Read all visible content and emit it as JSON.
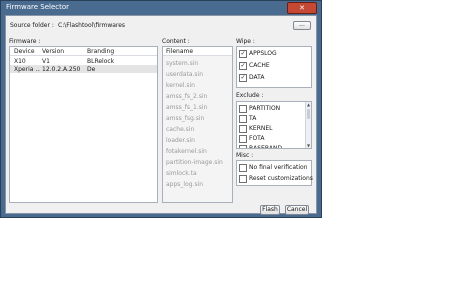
{
  "window": {
    "title": "Firmware Selector",
    "close_glyph": "✕"
  },
  "source": {
    "label": "Source folder :",
    "path": "C:\\Flashtool\\firmwares",
    "browse_label": "..."
  },
  "firmware": {
    "label": "Firmware :",
    "columns": [
      "Device",
      "Version",
      "Branding"
    ],
    "rows": [
      {
        "device": "X10",
        "version": "V1",
        "branding": "BLRelock",
        "selected": false
      },
      {
        "device": "Xperia ...",
        "version": "12.0.2.A.250",
        "branding": "De",
        "selected": true
      }
    ]
  },
  "content": {
    "label": "Content :",
    "column": "Filename",
    "items": [
      "system.sin",
      "userdata.sin",
      "kernel.sin",
      "amss_fs_2.sin",
      "amss_fs_1.sin",
      "amss_fsg.sin",
      "cache.sin",
      "loader.sin",
      "fotakernel.sin",
      "partition-image.sin",
      "simlock.ta",
      "apps_log.sin"
    ]
  },
  "wipe": {
    "label": "Wipe :",
    "items": [
      {
        "label": "APPSLOG",
        "checked": true
      },
      {
        "label": "CACHE",
        "checked": true
      },
      {
        "label": "DATA",
        "checked": true
      }
    ]
  },
  "exclude": {
    "label": "Exclude :",
    "items": [
      {
        "label": "PARTITION",
        "checked": false
      },
      {
        "label": "TA",
        "checked": false
      },
      {
        "label": "KERNEL",
        "checked": false
      },
      {
        "label": "FOTA",
        "checked": false
      },
      {
        "label": "BASEBAND",
        "checked": false
      }
    ]
  },
  "misc": {
    "label": "Misc :",
    "items": [
      {
        "label": "No final verification",
        "checked": false
      },
      {
        "label": "Reset customizations",
        "checked": false
      }
    ]
  },
  "buttons": {
    "flash": "Flash",
    "cancel": "Cancel"
  },
  "colors": {
    "titlebar": "#4a6b90",
    "close": "#c44834",
    "client": "#f0f0f0",
    "selected_row": "#e4e4e4"
  }
}
